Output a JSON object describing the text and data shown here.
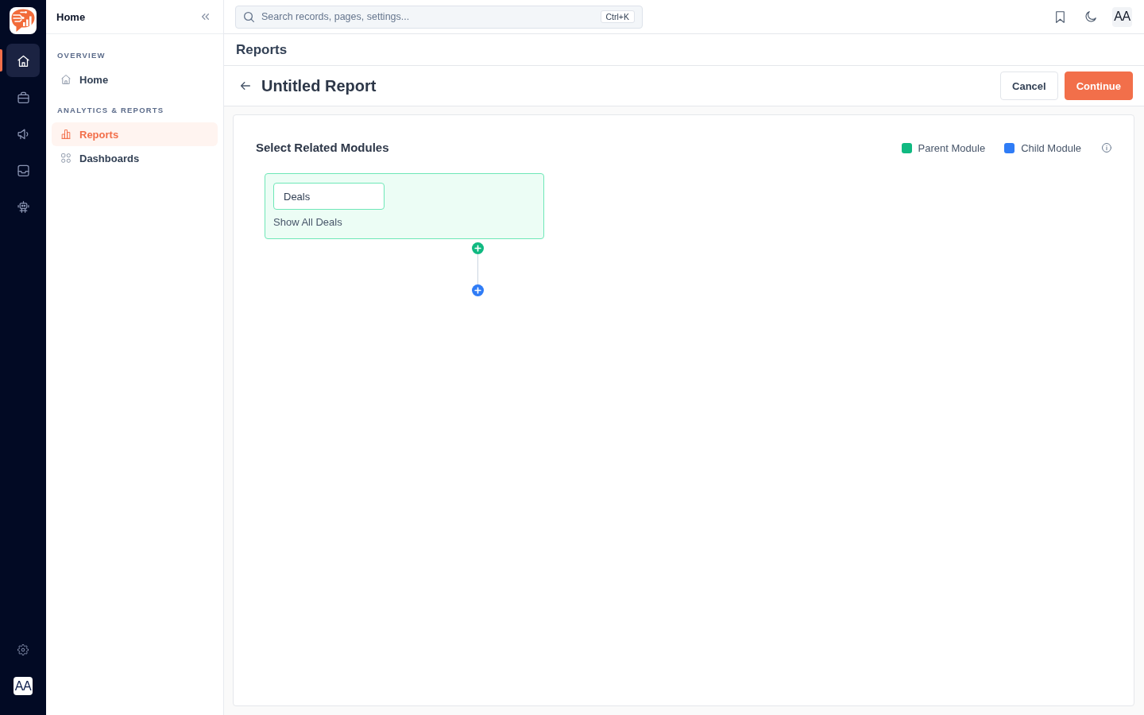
{
  "rail": {
    "nav": [
      {
        "selected": true
      },
      {
        "selected": false
      },
      {
        "selected": false
      },
      {
        "selected": false
      },
      {
        "selected": false
      }
    ],
    "avatar": "AA"
  },
  "sidebar": {
    "title": "Home",
    "sections": [
      {
        "heading": "OVERVIEW",
        "items": [
          {
            "label": "Home",
            "selected": false
          }
        ]
      },
      {
        "heading": "ANALYTICS & REPORTS",
        "items": [
          {
            "label": "Reports",
            "selected": true
          },
          {
            "label": "Dashboards",
            "selected": false
          }
        ]
      }
    ]
  },
  "topbar": {
    "search": {
      "placeholder": "Search records, pages, settings...",
      "shortcut": "Ctrl+K"
    },
    "avatar": "AA"
  },
  "page": {
    "title": "Reports"
  },
  "report": {
    "title": "Untitled Report",
    "buttons": [
      {
        "label": "Cancel",
        "kind": "secondary"
      },
      {
        "label": "Continue",
        "kind": "primary"
      }
    ]
  },
  "builder": {
    "heading": "Select Related Modules",
    "legend": [
      {
        "label": "Parent Module",
        "color": "#10b981"
      },
      {
        "label": "Child Module",
        "color": "#2f7cf6"
      }
    ],
    "nodes": [
      {
        "module": "Deals",
        "filter": "Show All Deals"
      }
    ]
  }
}
